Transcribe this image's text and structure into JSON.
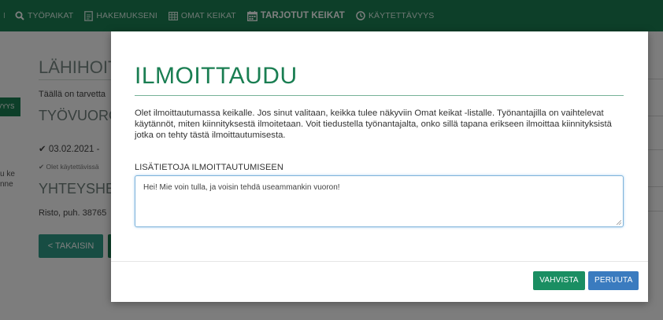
{
  "nav": {
    "separator": "I",
    "items": [
      {
        "label": "TYÖPAIKAT",
        "icon": "search-icon",
        "active": false
      },
      {
        "label": "HAKEMUKSENI",
        "icon": "document-icon",
        "active": false
      },
      {
        "label": "OMAT KEIKAT",
        "icon": "table-icon",
        "active": false
      },
      {
        "label": "TARJOTUT KEIKAT",
        "icon": "calendar-icon",
        "active": true
      },
      {
        "label": "KÄYTETTÄVYYS",
        "icon": "clock-icon",
        "active": false
      }
    ]
  },
  "background": {
    "title": "LÄHIHOITA",
    "description": "Täällä on tarvetta",
    "shifts_heading": "TYÖVUORO",
    "shift_date": "03.02.2021 -",
    "availability_note": "Olet käytettävissä",
    "contact_heading": "YHTEYSHEN",
    "contact_text": "Risto, puh. 38765",
    "back_button": "< TAKAISIN",
    "left_tab": "VYYS",
    "left_text_1": "u ke",
    "left_text_2": "nne"
  },
  "modal": {
    "title": "ILMOITTAUDU",
    "intro": "Olet ilmoittautumassa keikalle. Jos sinut valitaan, keikka tulee näkyviin Omat keikat -listalle. Työnantajilla on vaihtelevat käytännöt, miten kiinnityksestä ilmoitetaan. Voit tiedustella työnantajalta, onko sillä tapana erikseen ilmoittaa kiinnityksistä jotka on tehty tästä ilmoittautumisesta.",
    "field_label": "LISÄTIETOJA ILMOITTAUTUMISEEN",
    "field_value": "Hei! Mie voin tulla, ja voisin tehdä useammankin vuoron!",
    "confirm_button": "VAHVISTA",
    "cancel_button": "PERUUTA"
  },
  "colors": {
    "brand_green": "#1a7e52",
    "confirm_green": "#1a8e62",
    "cancel_blue": "#3a7bbf"
  }
}
